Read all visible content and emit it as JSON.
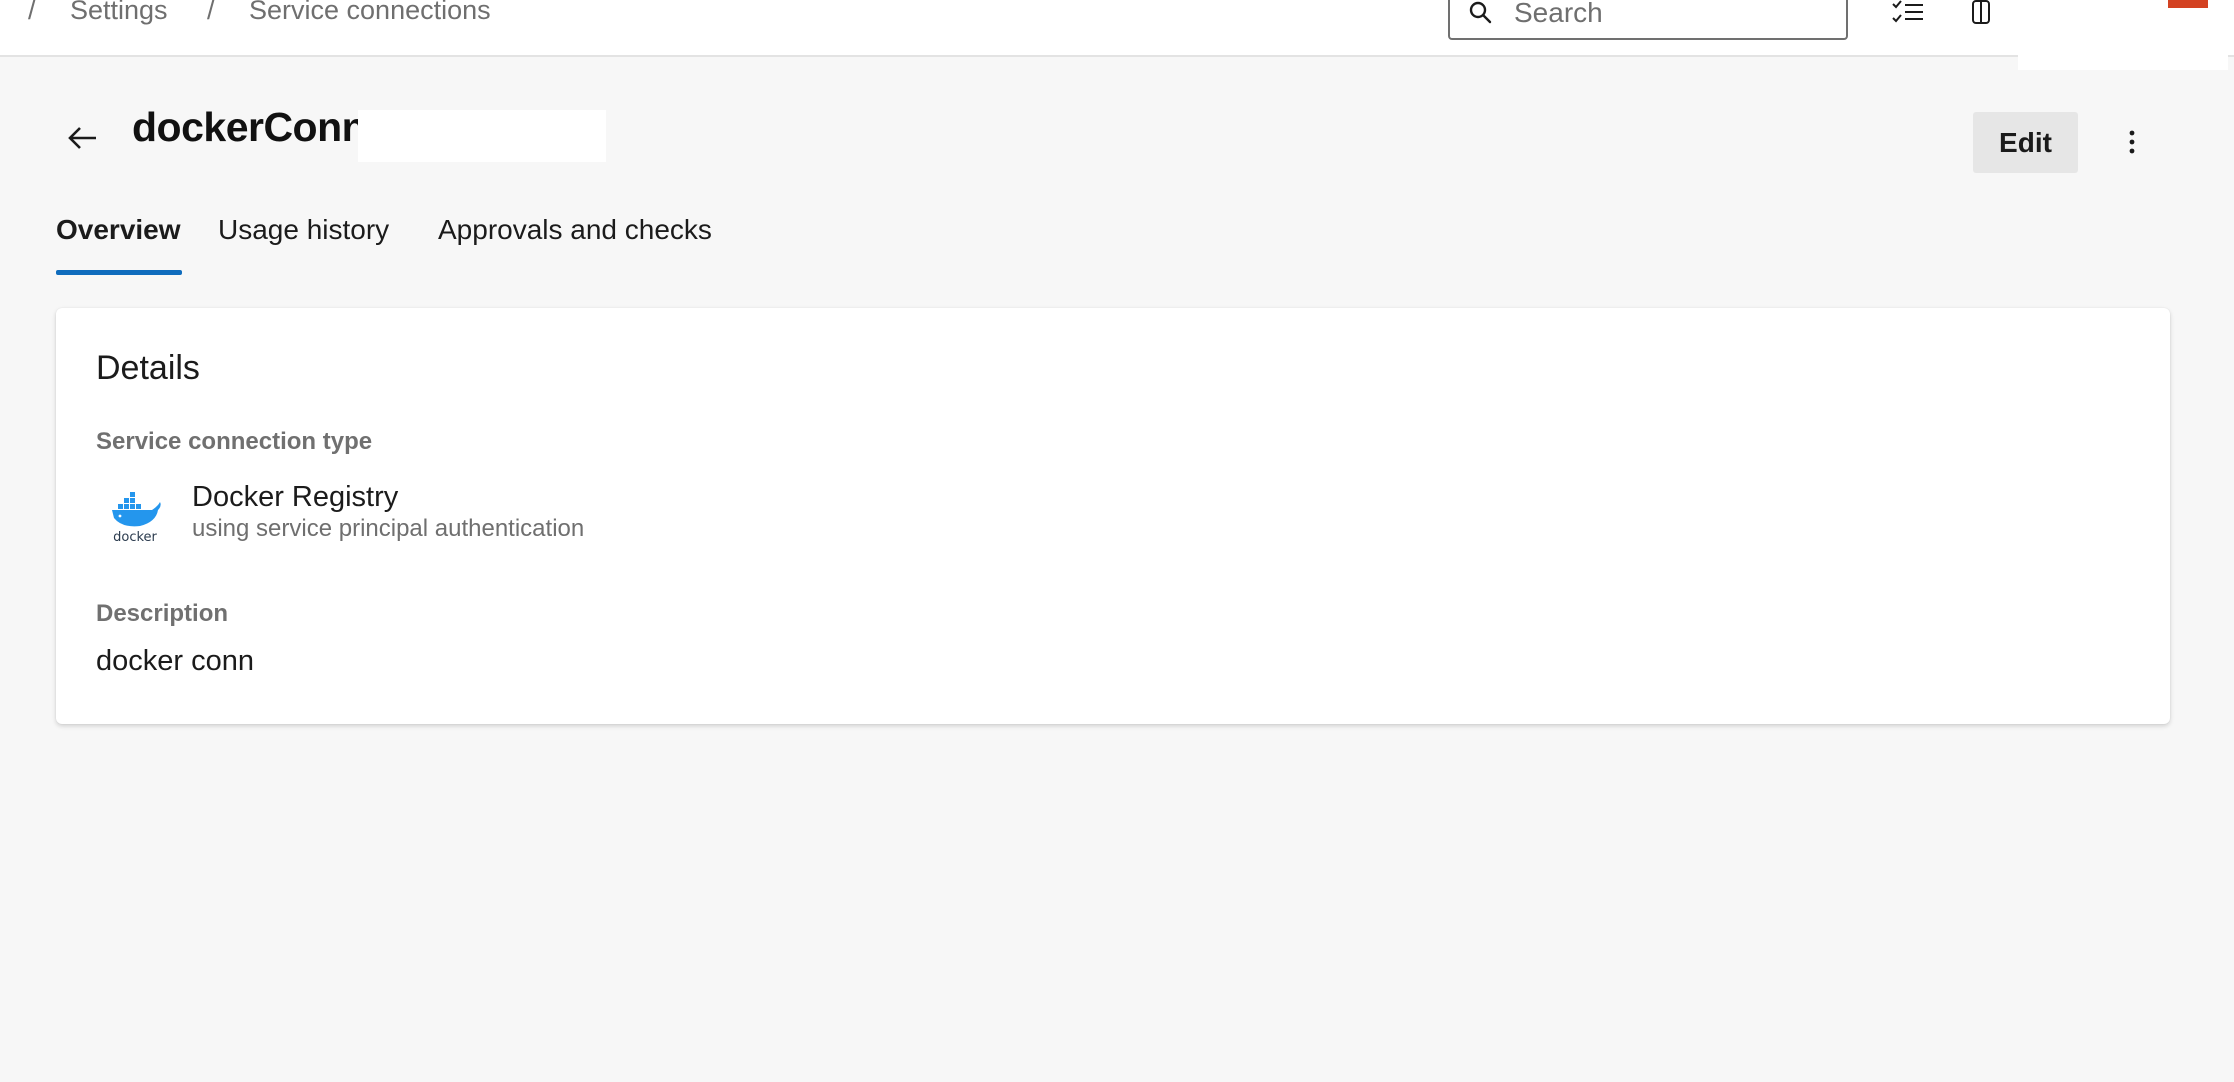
{
  "breadcrumb": {
    "separator": "/",
    "items": [
      "Settings",
      "Service connections"
    ]
  },
  "search": {
    "placeholder": "Search"
  },
  "toolbar_icons": [
    "task-list-icon",
    "clipboard-icon",
    "help-icon",
    "settings-icon"
  ],
  "header": {
    "title": "dockerConn",
    "edit_label": "Edit"
  },
  "tabs": [
    {
      "label": "Overview",
      "active": true
    },
    {
      "label": "Usage history",
      "active": false
    },
    {
      "label": "Approvals and checks",
      "active": false
    }
  ],
  "details": {
    "title": "Details",
    "type_label": "Service connection type",
    "type_name": "Docker Registry",
    "type_subtitle": "using service principal authentication",
    "logo_text": "docker",
    "description_label": "Description",
    "description_value": "docker conn"
  },
  "colors": {
    "accent": "#0f6cbd",
    "docker_blue": "#2496ed",
    "avatar_red": "#d34222"
  }
}
